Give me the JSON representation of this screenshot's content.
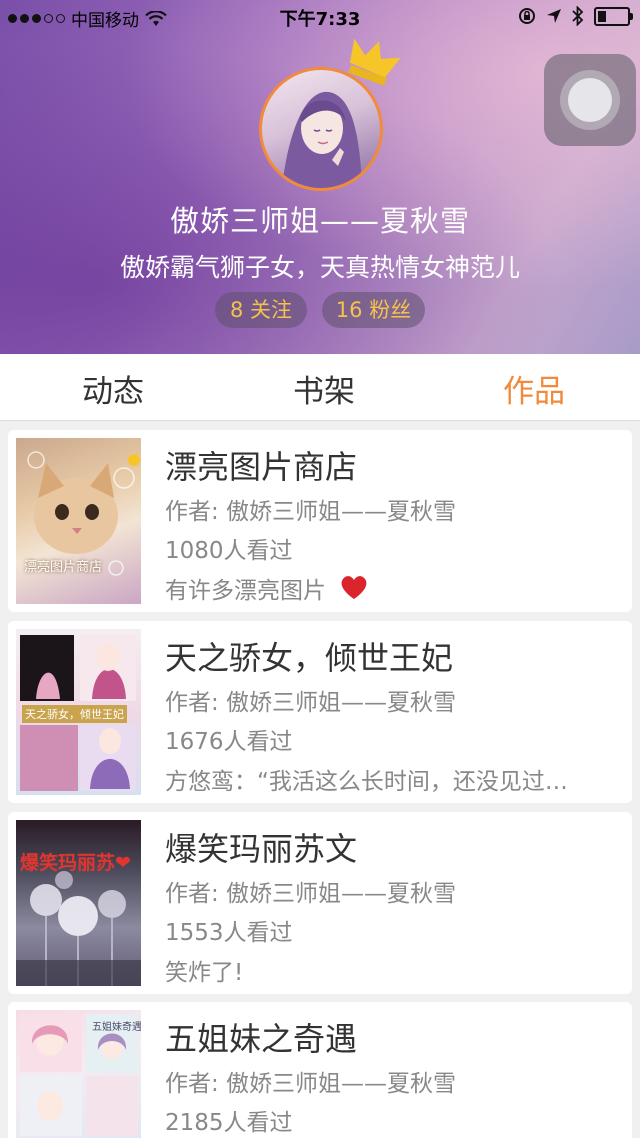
{
  "status_bar": {
    "carrier": "中国移动",
    "time": "下午7:33"
  },
  "profile": {
    "name": "傲娇三师姐——夏秋雪",
    "bio": "傲娇霸气狮子女，天真热情女神范儿",
    "following": "8 关注",
    "followers": "16 粉丝"
  },
  "tabs": [
    {
      "label": "动态",
      "active": false
    },
    {
      "label": "书架",
      "active": false
    },
    {
      "label": "作品",
      "active": true
    }
  ],
  "works": [
    {
      "title": "漂亮图片商店",
      "author": "作者: 傲娇三师姐——夏秋雪",
      "views": "1080人看过",
      "desc": "有许多漂亮图片",
      "cover_text": "漂亮图片商店"
    },
    {
      "title": "天之骄女，倾世王妃",
      "author": "作者: 傲娇三师姐——夏秋雪",
      "views": "1676人看过",
      "desc": "方悠鸾：“我活这么长时间，还没见过…",
      "cover_text": "天之骄女，倾世王妃"
    },
    {
      "title": "爆笑玛丽苏文",
      "author": "作者: 傲娇三师姐——夏秋雪",
      "views": "1553人看过",
      "desc": "笑炸了!",
      "cover_text": "爆笑玛丽苏❤"
    },
    {
      "title": "五姐妹之奇遇",
      "author": "作者: 傲娇三师姐——夏秋雪",
      "views": "2185人看过",
      "desc": "",
      "cover_text": "五姐妹奇遇"
    }
  ],
  "colors": {
    "accent": "#f28a3c",
    "stat_text": "#f5c24a",
    "heart": "#d9252b"
  }
}
